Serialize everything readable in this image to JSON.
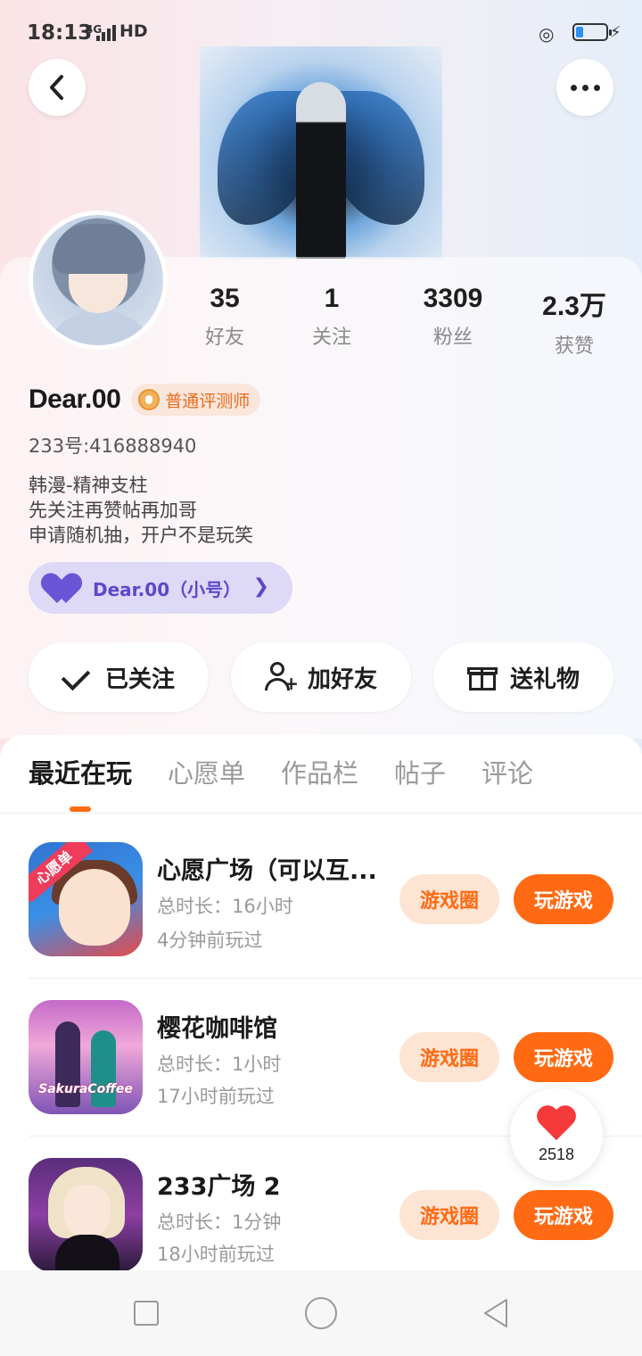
{
  "status_bar": {
    "time": "18:13",
    "network": "4G",
    "hd": "HD",
    "battery_level": 0.25,
    "battery_color": "#2e8ff0"
  },
  "header": {
    "back_icon": "chevron-left-icon",
    "more_icon": "more-dots-icon"
  },
  "profile": {
    "stats": [
      {
        "value": "35",
        "label": "好友"
      },
      {
        "value": "1",
        "label": "关注"
      },
      {
        "value": "3309",
        "label": "粉丝"
      },
      {
        "value": "2.3万",
        "label": "获赞"
      }
    ],
    "username": "Dear.00",
    "badge": "普通评测师",
    "uid": "233号:416888940",
    "bio": [
      "韩漫-精神支柱",
      "先关注再赞帖再加哥",
      "申请随机抽，开户不是玩笑"
    ],
    "alt_account": "Dear.00（小号）"
  },
  "actions": {
    "follow": "已关注",
    "add_friend": "加好友",
    "send_gift": "送礼物"
  },
  "tabs": [
    "最近在玩",
    "心愿单",
    "作品栏",
    "帖子",
    "评论"
  ],
  "games": [
    {
      "title": "心愿广场（可以互...",
      "duration": "总时长：16小时",
      "last_played": "4分钟前玩过",
      "circle": "游戏圈",
      "play": "玩游戏",
      "icon_label": "心愿单"
    },
    {
      "title": "樱花咖啡馆",
      "duration": "总时长：1小时",
      "last_played": "17小时前玩过",
      "circle": "游戏圈",
      "play": "玩游戏",
      "icon_label": "SakuraCoffee"
    },
    {
      "title": "233广场 2",
      "duration": "总时长：1分钟",
      "last_played": "18小时前玩过",
      "circle": "游戏圈",
      "play": "玩游戏"
    }
  ],
  "likes": {
    "count": "2518"
  },
  "colors": {
    "accent": "#ff6a13",
    "accent_light": "#fde4d3",
    "alt_account_bg": "#ddd9f6",
    "alt_account_text": "#5b48c9"
  }
}
